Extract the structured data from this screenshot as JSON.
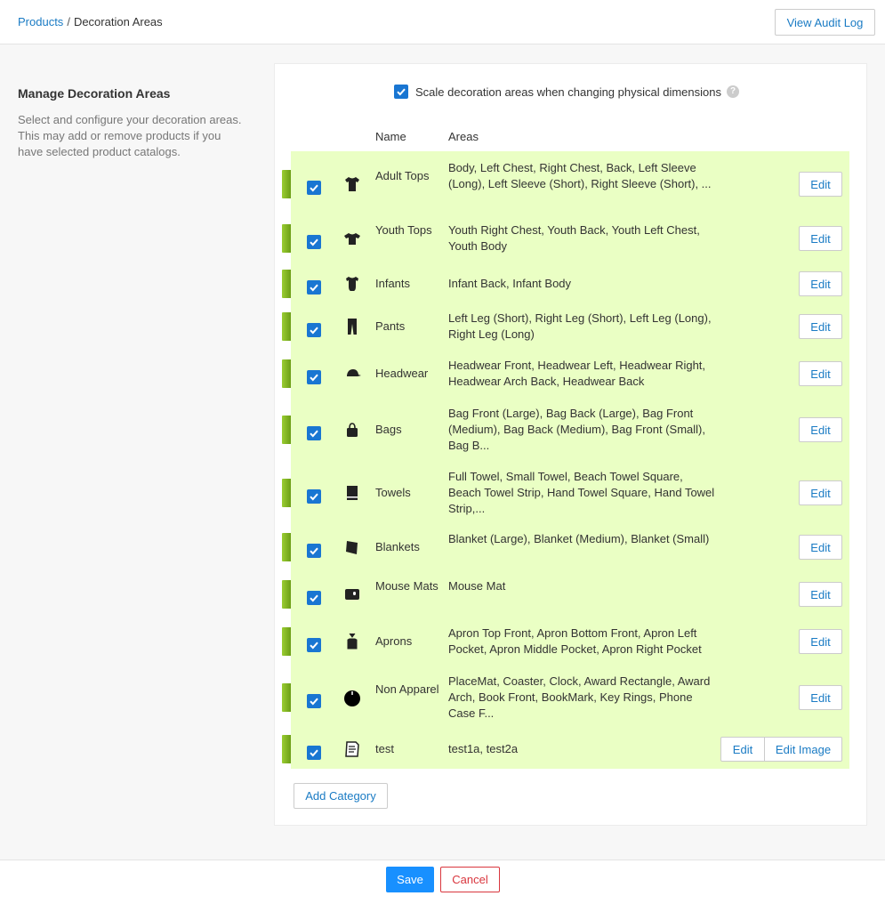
{
  "breadcrumb": {
    "parent": "Products",
    "separator": "/",
    "current": "Decoration Areas"
  },
  "header": {
    "audit_label": "View Audit Log"
  },
  "sidebar": {
    "title": "Manage Decoration Areas",
    "description": "Select and configure your decoration areas. This may add or remove products if you have selected product catalogs."
  },
  "scale": {
    "label": "Scale decoration areas when changing physical dimensions",
    "checked": true,
    "help": "?"
  },
  "table": {
    "headers": {
      "name": "Name",
      "areas": "Areas"
    },
    "edit_label": "Edit",
    "edit_image_label": "Edit Image",
    "rows": [
      {
        "name": "Adult Tops",
        "areas": "Body, Left Chest, Right Chest, Back, Left Sleeve (Long), Left Sleeve (Short), Right Sleeve (Short), ...",
        "icon": "t-shirt-icon",
        "checked": true
      },
      {
        "name": "Youth Tops",
        "areas": "Youth Right Chest, Youth Back, Youth Left Chest, Youth Body",
        "icon": "youth-shirt-icon",
        "checked": true
      },
      {
        "name": "Infants",
        "areas": "Infant Back, Infant Body",
        "icon": "onesie-icon",
        "checked": true
      },
      {
        "name": "Pants",
        "areas": "Left Leg (Short), Right Leg (Short), Left Leg (Long), Right Leg (Long)",
        "icon": "pants-icon",
        "checked": true
      },
      {
        "name": "Headwear",
        "areas": "Headwear Front, Headwear Left, Headwear Right, Headwear Arch Back, Headwear Back",
        "icon": "cap-icon",
        "checked": true
      },
      {
        "name": "Bags",
        "areas": "Bag Front (Large), Bag Back (Large), Bag Front (Medium), Bag Back (Medium), Bag Front (Small), Bag B...",
        "icon": "bag-icon",
        "checked": true
      },
      {
        "name": "Towels",
        "areas": "Full Towel, Small Towel, Beach Towel Square, Beach Towel Strip, Hand Towel Square, Hand Towel Strip,...",
        "icon": "towel-icon",
        "checked": true
      },
      {
        "name": "Blankets",
        "areas": "Blanket (Large), Blanket (Medium), Blanket (Small)",
        "icon": "blanket-icon",
        "checked": true
      },
      {
        "name": "Mouse Mats",
        "areas": "Mouse Mat",
        "icon": "mouse-mat-icon",
        "checked": true
      },
      {
        "name": "Aprons",
        "areas": "Apron Top Front, Apron Bottom Front, Apron Left Pocket, Apron Middle Pocket, Apron Right Pocket",
        "icon": "apron-icon",
        "checked": true
      },
      {
        "name": "Non Apparel",
        "areas": "PlaceMat, Coaster, Clock, Award Rectangle, Award Arch, Book Front, BookMark, Key Rings, Phone Case F...",
        "icon": "clock-icon",
        "checked": true
      },
      {
        "name": "test",
        "areas": "test1a, test2a",
        "icon": "document-icon",
        "checked": true
      }
    ]
  },
  "add_category_label": "Add Category",
  "footer": {
    "save_label": "Save",
    "cancel_label": "Cancel"
  },
  "colors": {
    "accent": "#1a7bc4",
    "row_bg": "#eaffc4",
    "bar": "#8bc34a",
    "save": "#1890ff",
    "cancel": "#d9363e"
  }
}
